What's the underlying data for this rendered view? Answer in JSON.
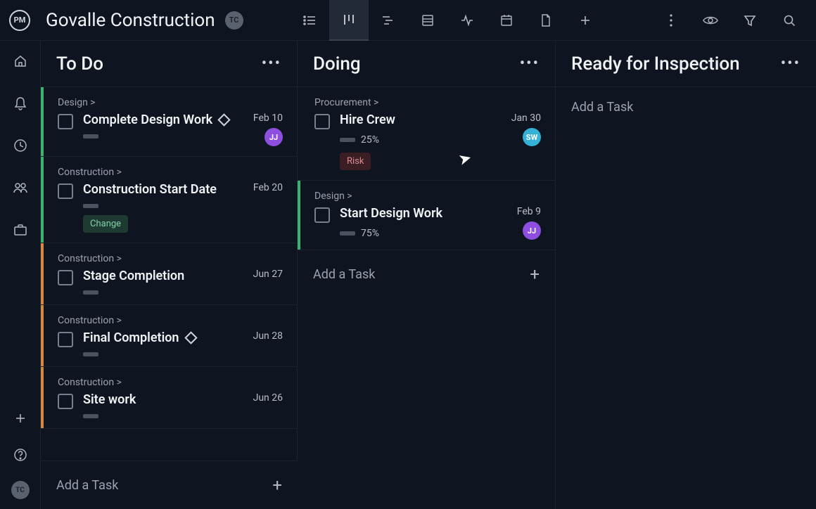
{
  "app": {
    "logo_text": "PM",
    "project_title": "Govalle Construction",
    "user_initials": "TC"
  },
  "columns": [
    {
      "title": "To Do",
      "add_task_label": "Add a Task",
      "cards": [
        {
          "crumb": "Design >",
          "title": "Complete Design Work",
          "milestone": true,
          "date": "Feb 10",
          "progress_text": "",
          "assignee": "JJ",
          "assignee_color": "jj",
          "stripe": "green",
          "tag": ""
        },
        {
          "crumb": "Construction >",
          "title": "Construction Start Date",
          "milestone": false,
          "date": "Feb 20",
          "progress_text": "",
          "assignee": "",
          "assignee_color": "",
          "stripe": "green",
          "tag": "Change"
        },
        {
          "crumb": "Construction >",
          "title": "Stage Completion",
          "milestone": false,
          "date": "Jun 27",
          "progress_text": "",
          "assignee": "",
          "assignee_color": "",
          "stripe": "orange",
          "tag": ""
        },
        {
          "crumb": "Construction >",
          "title": "Final Completion",
          "milestone": true,
          "date": "Jun 28",
          "progress_text": "",
          "assignee": "",
          "assignee_color": "",
          "stripe": "orange",
          "tag": ""
        },
        {
          "crumb": "Construction >",
          "title": "Site work",
          "milestone": false,
          "date": "Jun 26",
          "progress_text": "",
          "assignee": "",
          "assignee_color": "",
          "stripe": "orange",
          "tag": ""
        }
      ]
    },
    {
      "title": "Doing",
      "add_task_label": "Add a Task",
      "cards": [
        {
          "crumb": "Procurement >",
          "title": "Hire Crew",
          "milestone": false,
          "date": "Jan 30",
          "progress_text": "25%",
          "assignee": "SW",
          "assignee_color": "sw",
          "stripe": "",
          "tag": "Risk"
        },
        {
          "crumb": "Design >",
          "title": "Start Design Work",
          "milestone": false,
          "date": "Feb 9",
          "progress_text": "75%",
          "assignee": "JJ",
          "assignee_color": "jj",
          "stripe": "green",
          "tag": ""
        }
      ]
    },
    {
      "title": "Ready for Inspection",
      "add_task_label": "Add a Task",
      "cards": []
    }
  ]
}
